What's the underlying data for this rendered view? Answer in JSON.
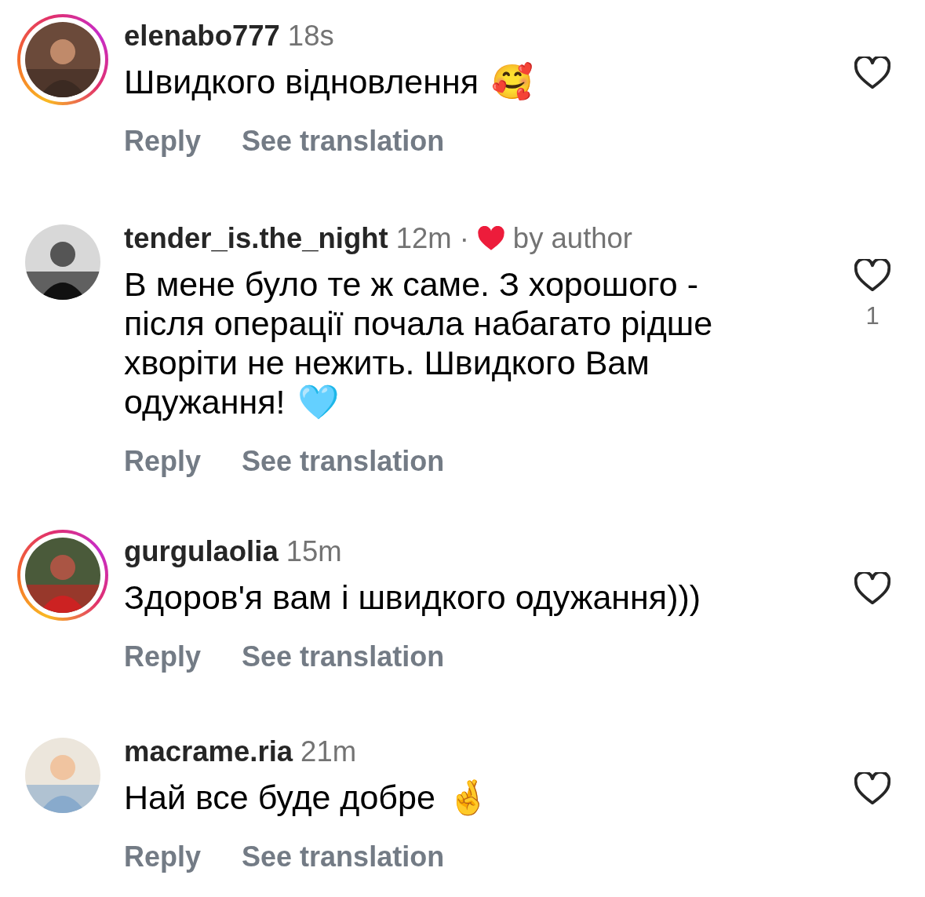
{
  "comments": [
    {
      "username": "elenabo777",
      "time": "18s",
      "has_story": true,
      "liked_by_author": false,
      "text": "Швидкого відновлення",
      "emoji": "🥰",
      "actions": [
        "Reply",
        "See translation"
      ]
    },
    {
      "username": "tender_is.the_night",
      "time": "12m",
      "has_story": false,
      "liked_by_author": true,
      "separator": "·",
      "author_label": "by author",
      "text": "В мене було те ж саме. З хорошого - після операції почала набагато рідше хворіти не нежить. Швидкого Вам одужання!",
      "emoji": "🩵",
      "like_count": "1",
      "actions": [
        "Reply",
        "See translation"
      ]
    },
    {
      "username": "gurgulaolia",
      "time": "15m",
      "has_story": true,
      "liked_by_author": false,
      "text": "Здоров'я вам і швидкого одужання)))",
      "actions": [
        "Reply",
        "See translation"
      ]
    },
    {
      "username": "macrame.ria",
      "time": "21m",
      "has_story": false,
      "liked_by_author": false,
      "text": "Най все буде добре",
      "emoji": "🤞",
      "actions": [
        "Reply",
        "See translation"
      ]
    }
  ]
}
